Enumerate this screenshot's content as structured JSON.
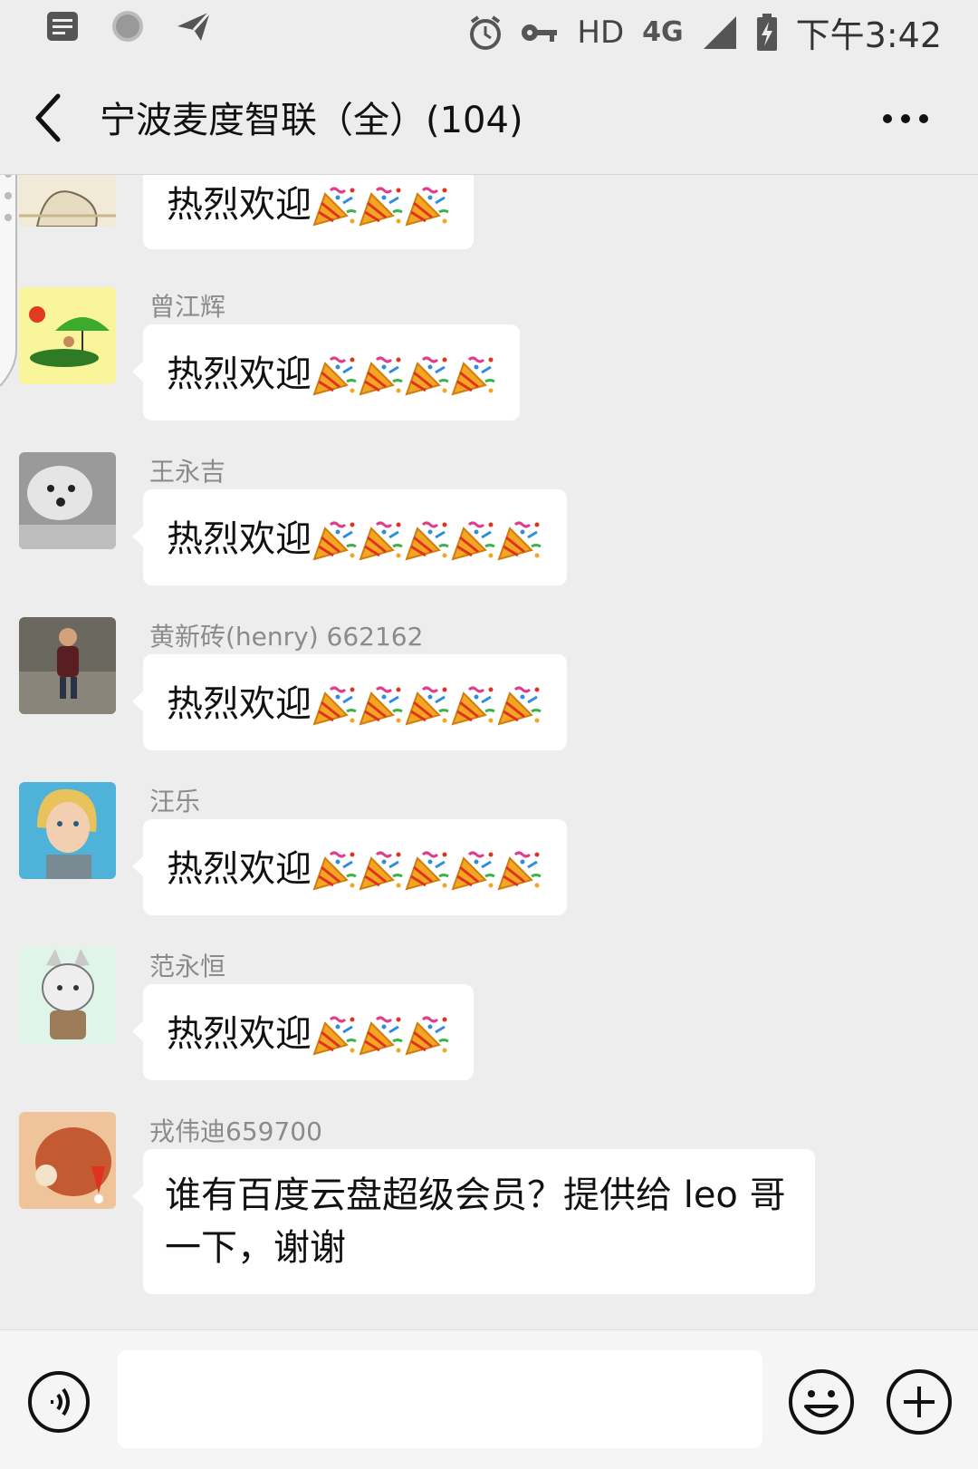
{
  "status_bar": {
    "network_label": "HD",
    "network_type": "4G",
    "time": "下午3:42",
    "left_icons": [
      "notes-icon",
      "circle-dots-icon",
      "send-icon"
    ],
    "right_icons": [
      "alarm-icon",
      "key-icon",
      "signal-icon",
      "battery-charging-icon"
    ]
  },
  "header": {
    "title": "宁波麦度智联（全）(104)",
    "back_icon": "back-arrow-icon",
    "more_icon": "more-dots-icon"
  },
  "messages": [
    {
      "sender": "",
      "text": "热烈欢迎",
      "emoji_count": 3,
      "avatar": "avatar-cartoon-sketch"
    },
    {
      "sender": "曾江辉",
      "text": "热烈欢迎",
      "emoji_count": 4,
      "avatar": "avatar-umbrella-cartoon"
    },
    {
      "sender": "王永吉",
      "text": "热烈欢迎",
      "emoji_count": 5,
      "avatar": "avatar-dog-photo"
    },
    {
      "sender": "黄新砖(henry) 662162",
      "text": "热烈欢迎",
      "emoji_count": 5,
      "avatar": "avatar-child-photo"
    },
    {
      "sender": "汪乐",
      "text": "热烈欢迎",
      "emoji_count": 5,
      "avatar": "avatar-anime-girl"
    },
    {
      "sender": "范永恒",
      "text": "热烈欢迎",
      "emoji_count": 3,
      "avatar": "avatar-wolf-cartoon"
    },
    {
      "sender": "戎伟迪659700",
      "text": "谁有百度云盘超级会员？提供给 leo 哥一下，谢谢",
      "emoji_count": 0,
      "avatar": "avatar-toy-photo"
    }
  ],
  "emoji_name": "party-popper-icon",
  "input_bar": {
    "placeholder": "",
    "voice_icon": "voice-icon",
    "emoji_icon": "emoji-smile-icon",
    "plus_icon": "plus-icon"
  },
  "colors": {
    "background": "#ededed",
    "bubble": "#ffffff",
    "sender_name": "#8b8b8b",
    "input_bar": "#f5f5f5"
  }
}
